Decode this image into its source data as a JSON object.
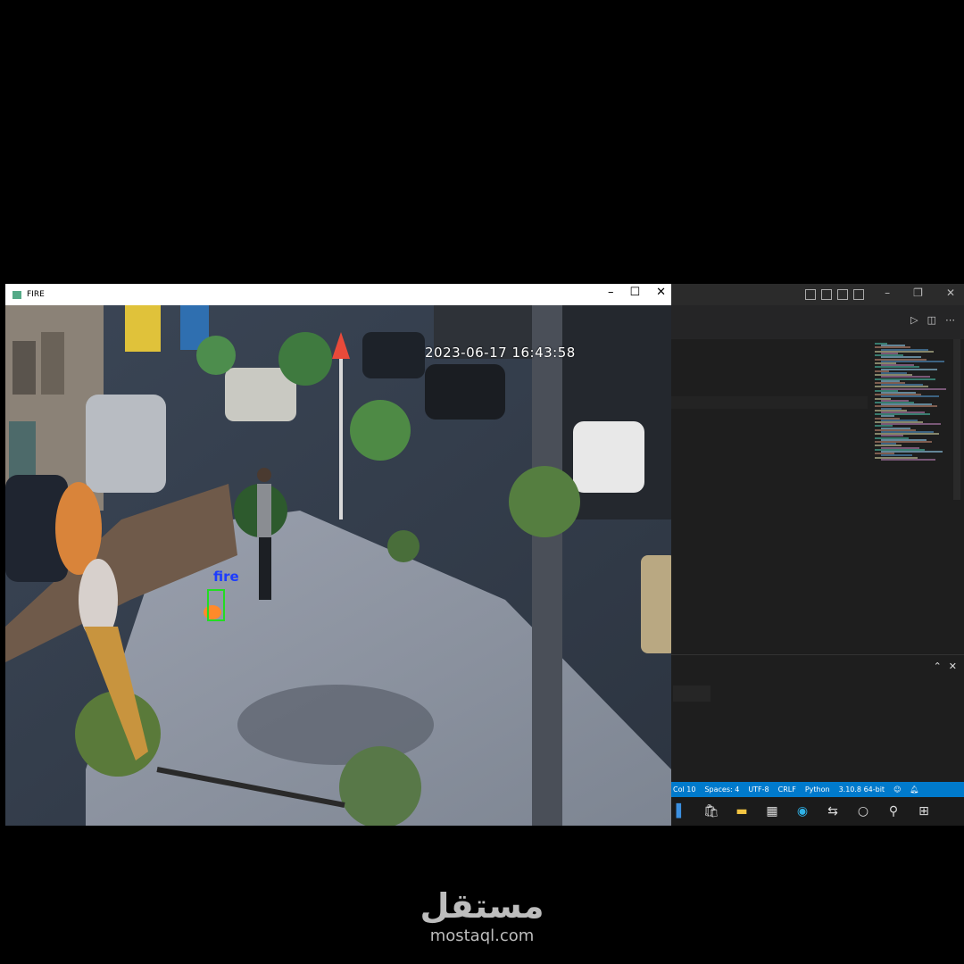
{
  "fire_window": {
    "title": "FIRE",
    "controls": {
      "minimize": "–",
      "maximize": "☐",
      "close": "✕"
    },
    "timestamp": "2023-06-17 16:43:58",
    "detection_label": "fire"
  },
  "vscode": {
    "status_bar": [
      "Col 10",
      "Spaces: 4",
      "UTF-8",
      "CRLF",
      "Python",
      "3.10.8 64-bit"
    ],
    "colors": {
      "status_bar": "#007acc",
      "editor_bg": "#1e1e1e",
      "detection_box": "#22dd22",
      "detection_label": "#1d3cff"
    }
  },
  "taskbar": {
    "icons": [
      "start-icon-edge",
      "store-icon",
      "file-explorer-icon",
      "calculator-icon",
      "edge-icon",
      "network-icon",
      "cortana-icon",
      "search-icon",
      "windows-icon"
    ]
  },
  "watermark": {
    "arabic": "مستقل",
    "latin": "mostaql.com"
  }
}
